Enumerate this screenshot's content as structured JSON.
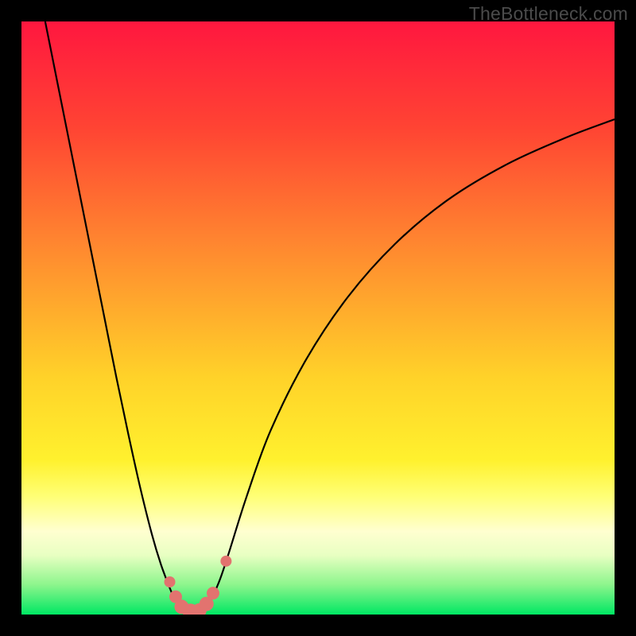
{
  "watermark": "TheBottleneck.com",
  "chart_data": {
    "type": "line",
    "title": "",
    "xlabel": "",
    "ylabel": "",
    "xlim": [
      0,
      100
    ],
    "ylim": [
      0,
      100
    ],
    "gradient_stops": [
      {
        "offset": 0,
        "color": "#ff173f"
      },
      {
        "offset": 18,
        "color": "#ff4433"
      },
      {
        "offset": 40,
        "color": "#ff8f2f"
      },
      {
        "offset": 60,
        "color": "#ffd229"
      },
      {
        "offset": 74,
        "color": "#fff12e"
      },
      {
        "offset": 80,
        "color": "#ffff75"
      },
      {
        "offset": 86,
        "color": "#ffffd0"
      },
      {
        "offset": 90,
        "color": "#e8ffc2"
      },
      {
        "offset": 95,
        "color": "#8cf58c"
      },
      {
        "offset": 100,
        "color": "#00e763"
      }
    ],
    "series": [
      {
        "name": "left-branch",
        "x": [
          4.0,
          6.0,
          8.0,
          10.0,
          12.0,
          14.0,
          16.0,
          18.0,
          20.0,
          22.0,
          23.5,
          25.0,
          26.0,
          27.0
        ],
        "y": [
          100.0,
          90.0,
          80.0,
          70.0,
          60.0,
          50.0,
          40.0,
          30.5,
          21.5,
          13.5,
          8.5,
          4.5,
          2.2,
          0.6
        ]
      },
      {
        "name": "right-branch",
        "x": [
          31.0,
          32.0,
          33.5,
          35.0,
          38.0,
          42.0,
          48.0,
          55.0,
          63.0,
          72.0,
          82.0,
          92.0,
          100.0
        ],
        "y": [
          0.6,
          2.5,
          6.0,
          10.5,
          20.0,
          31.0,
          43.0,
          53.5,
          62.5,
          70.0,
          76.0,
          80.5,
          83.5
        ]
      }
    ],
    "valley_floor": {
      "x_start": 27.0,
      "x_end": 31.0,
      "y": 0.0
    },
    "markers": {
      "name": "valley-markers",
      "color": "#e2736f",
      "points": [
        {
          "x": 25.0,
          "y": 5.5,
          "r": 7
        },
        {
          "x": 26.0,
          "y": 3.0,
          "r": 8
        },
        {
          "x": 27.0,
          "y": 1.3,
          "r": 9
        },
        {
          "x": 28.5,
          "y": 0.5,
          "r": 10
        },
        {
          "x": 30.0,
          "y": 0.7,
          "r": 9
        },
        {
          "x": 31.2,
          "y": 1.8,
          "r": 9
        },
        {
          "x": 32.3,
          "y": 3.6,
          "r": 8
        },
        {
          "x": 34.5,
          "y": 9.0,
          "r": 7
        }
      ]
    }
  }
}
